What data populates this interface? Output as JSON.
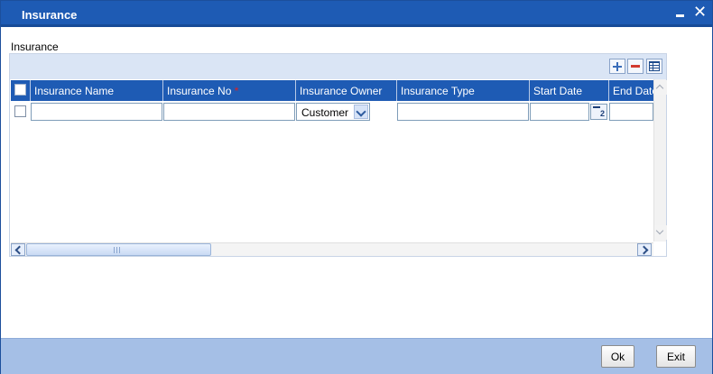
{
  "window": {
    "title": "Insurance",
    "minimize_icon": "minimize-icon",
    "close_label": "✕"
  },
  "section": {
    "label": "Insurance"
  },
  "toolbar": {
    "add_icon": "plus-icon",
    "delete_icon": "minus-icon",
    "view_icon": "single-record-view-icon"
  },
  "table": {
    "columns": [
      {
        "label": "Insurance Name",
        "required": false
      },
      {
        "label": "Insurance No",
        "required": true,
        "required_mark": "*"
      },
      {
        "label": "Insurance Owner",
        "required": false
      },
      {
        "label": "Insurance Type",
        "required": false
      },
      {
        "label": "Start Date",
        "required": false
      },
      {
        "label": "End Date",
        "required": false
      }
    ],
    "rows": [
      {
        "selected": false,
        "insurance_name": "",
        "insurance_no": "",
        "insurance_owner": "Customer",
        "insurance_type": "",
        "start_date": "",
        "end_date": ""
      }
    ],
    "calendar_icon": "calendar-icon",
    "scroll_grip": "III"
  },
  "actions": {
    "ok_label": "Ok",
    "exit_label": "Exit"
  },
  "colors": {
    "title_bar": "#1e5bb4",
    "header_row": "#1e5bb4",
    "toolbar_band": "#dae5f5",
    "bottom_bar": "#a5bfe6",
    "required_mark": "#e02020"
  }
}
